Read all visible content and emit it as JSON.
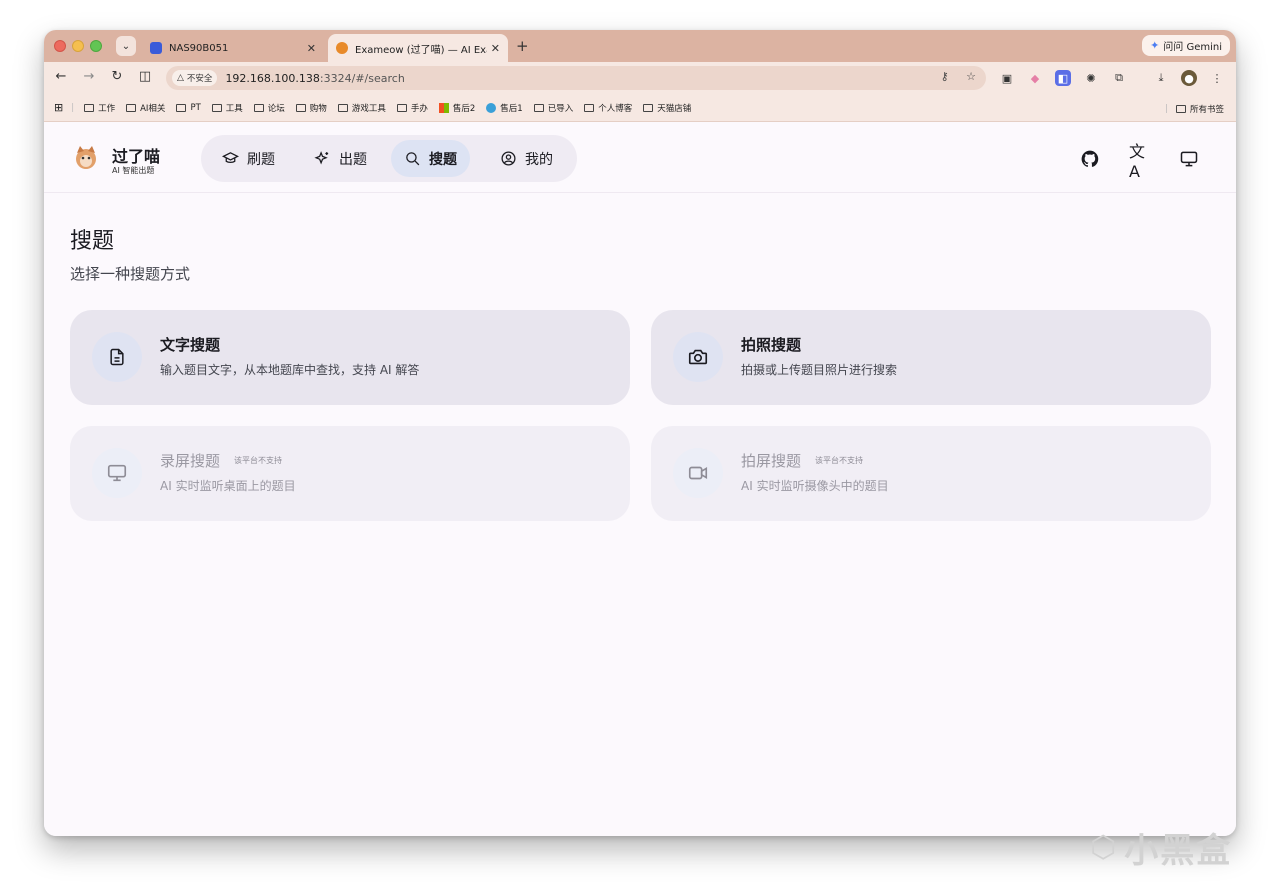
{
  "browser": {
    "tabs": [
      {
        "title": "NAS90B051",
        "favicon_color": "#3a5bd9",
        "active": false
      },
      {
        "title": "Exameow (过了喵) — AI Exam",
        "favicon_color": "#e88a2a",
        "active": true
      }
    ],
    "close_glyph": "✕",
    "new_tab_glyph": "+",
    "gemini_label": "问问 Gemini",
    "insecure_label": "不安全",
    "url_host": "192.168.100.138",
    "url_rest": ":3324/#/search",
    "bookmarks": [
      "工作",
      "AI相关",
      "PT",
      "工具",
      "论坛",
      "购物",
      "游戏工具",
      "手办",
      "售后2",
      "售后1",
      "已导入",
      "个人博客",
      "天猫店铺"
    ],
    "all_bookmarks_label": "所有书签"
  },
  "app": {
    "brand_name": "过了喵",
    "brand_sub": "AI 智能出题",
    "nav": [
      {
        "label": "刷题",
        "icon": "graduation-cap-icon",
        "active": false
      },
      {
        "label": "出题",
        "icon": "sparkles-icon",
        "active": false
      },
      {
        "label": "搜题",
        "icon": "search-icon",
        "active": true
      },
      {
        "label": "我的",
        "icon": "user-circle-icon",
        "active": false
      }
    ],
    "header_icons": [
      "github-icon",
      "translate-icon",
      "monitor-icon"
    ]
  },
  "page": {
    "title": "搜题",
    "subtitle": "选择一种搜题方式",
    "cards": [
      {
        "title": "文字搜题",
        "desc": "输入题目文字，从本地题库中查找，支持 AI 解答",
        "icon": "file-text-icon",
        "disabled": false,
        "badge": ""
      },
      {
        "title": "拍照搜题",
        "desc": "拍摄或上传题目照片进行搜索",
        "icon": "camera-icon",
        "disabled": false,
        "badge": ""
      },
      {
        "title": "录屏搜题",
        "desc": "AI 实时监听桌面上的题目",
        "icon": "monitor-icon",
        "disabled": true,
        "badge": "该平台不支持"
      },
      {
        "title": "拍屏搜题",
        "desc": "AI 实时监听摄像头中的题目",
        "icon": "video-icon",
        "disabled": true,
        "badge": "该平台不支持"
      }
    ]
  },
  "watermark": "小黑盒",
  "colors": {
    "accent": "#dde3f3",
    "tabbar": "#dcb3a2",
    "toolbar": "#f6e8e2"
  }
}
